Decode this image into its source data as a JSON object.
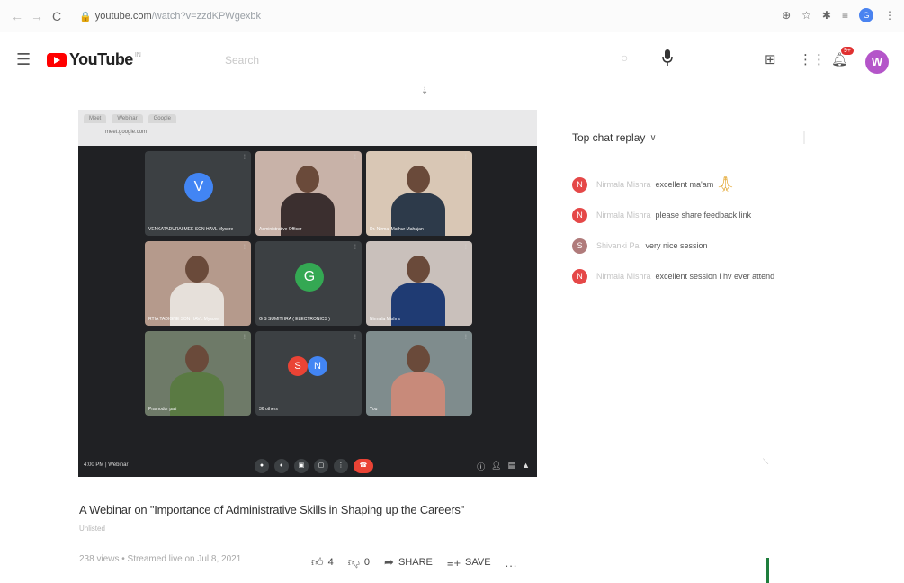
{
  "browser": {
    "url_host": "youtube.com",
    "url_path": "/watch?v=zzdKPWgexbk",
    "profile_initial": "G"
  },
  "header": {
    "logo_text": "YouTube",
    "logo_superscript": "IN",
    "search_placeholder": "Search",
    "notification_count": "9+",
    "avatar_initial": "W"
  },
  "video": {
    "inner_browser": {
      "tabs": [
        "Meet",
        "Webinar",
        "Google"
      ],
      "url": "meet.google.com"
    },
    "meeting": {
      "tiles": [
        {
          "name": "VENKATADURAI MEE SON HAVL Mysore",
          "avatar": "V",
          "avatar_color": "#4285f4",
          "kind": "avatar"
        },
        {
          "name": "Administrative Officer",
          "kind": "person",
          "bg": "#c8b2a8",
          "body": "#3b2f2f"
        },
        {
          "name": "Dr. Nirmal Mathur Mahajan",
          "kind": "person",
          "bg": "#d9c7b5",
          "body": "#2d3a4a"
        },
        {
          "name": "RTIA TADIGNE SON HAVL Mysore",
          "kind": "person",
          "bg": "#b59a8c",
          "body": "#e6e0da"
        },
        {
          "name": "G S SUMITHRA ( ELECTRONICS )",
          "avatar": "G",
          "avatar_color": "#34a853",
          "kind": "avatar"
        },
        {
          "name": "Nirmala Mishra",
          "kind": "person",
          "bg": "#c9c0bb",
          "body": "#1f3b73"
        },
        {
          "name": "Pramodur pati",
          "kind": "person",
          "bg": "#6e7a68",
          "body": "#5a7a43"
        },
        {
          "name": "36 others",
          "kind": "others",
          "avatars": [
            "S",
            "N"
          ],
          "avatar_colors": [
            "#ea4335",
            "#4285f4"
          ]
        },
        {
          "name": "You",
          "kind": "person",
          "bg": "#7f8c8d",
          "body": "#c88a7a"
        }
      ],
      "time_label": "4:00 PM | Webinar"
    }
  },
  "title": "A Webinar on \"Importance of Administrative Skills in Shaping up the Careers\"",
  "channel": "Unlisted",
  "meta": "238 views • Streamed live on Jul 8, 2021",
  "actions": {
    "like_count": "4",
    "dislike_count": "0",
    "share_label": "SHARE",
    "save_label": "SAVE",
    "more_label": "..."
  },
  "chat": {
    "header": "Top chat replay",
    "messages": [
      {
        "initial": "N",
        "color": "#e54848",
        "author": "Nirmala Mishra",
        "text": "excellent ma'am",
        "emoji": true
      },
      {
        "initial": "N",
        "color": "#e54848",
        "author": "Nirmala Mishra",
        "text": "please share feedback link",
        "emoji": false
      },
      {
        "initial": "S",
        "color": "#b07b7b",
        "author": "Shivanki Pal",
        "text": "very nice session",
        "emoji": false
      },
      {
        "initial": "N",
        "color": "#e54848",
        "author": "Nirmala Mishra",
        "text": "excellent session i hv ever attend",
        "emoji": false
      }
    ]
  }
}
